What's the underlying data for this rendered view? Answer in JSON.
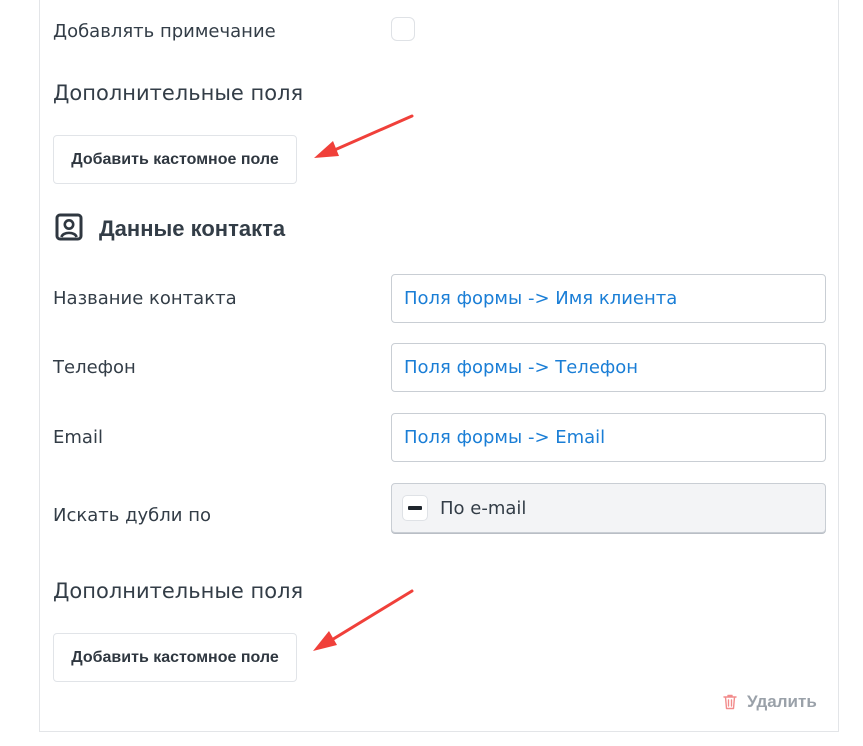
{
  "note_row": {
    "label": "Добавлять примечание",
    "checked": false
  },
  "extra_fields_1": {
    "title": "Дополнительные поля",
    "button_label": "Добавить кастомное поле"
  },
  "contact_section": {
    "icon": "contact-card-icon",
    "title": "Данные контакта",
    "fields": [
      {
        "label": "Название контакта",
        "value": "Поля формы -> Имя клиента"
      },
      {
        "label": "Телефон",
        "value": "Поля формы -> Телефон"
      },
      {
        "label": "Email",
        "value": "Поля формы -> Email"
      }
    ],
    "duplicates": {
      "label": "Искать дубли по",
      "value": "По e-mail",
      "icon": "minus-icon"
    }
  },
  "extra_fields_2": {
    "title": "Дополнительные поля",
    "button_label": "Добавить кастомное поле"
  },
  "delete": {
    "label": "Удалить",
    "icon": "trash-icon"
  },
  "colors": {
    "link": "#1a7ed6",
    "arrow": "#f0403a",
    "text": "#333d47",
    "muted": "#9aa1a9",
    "delete_icon": "#f28b8b"
  }
}
